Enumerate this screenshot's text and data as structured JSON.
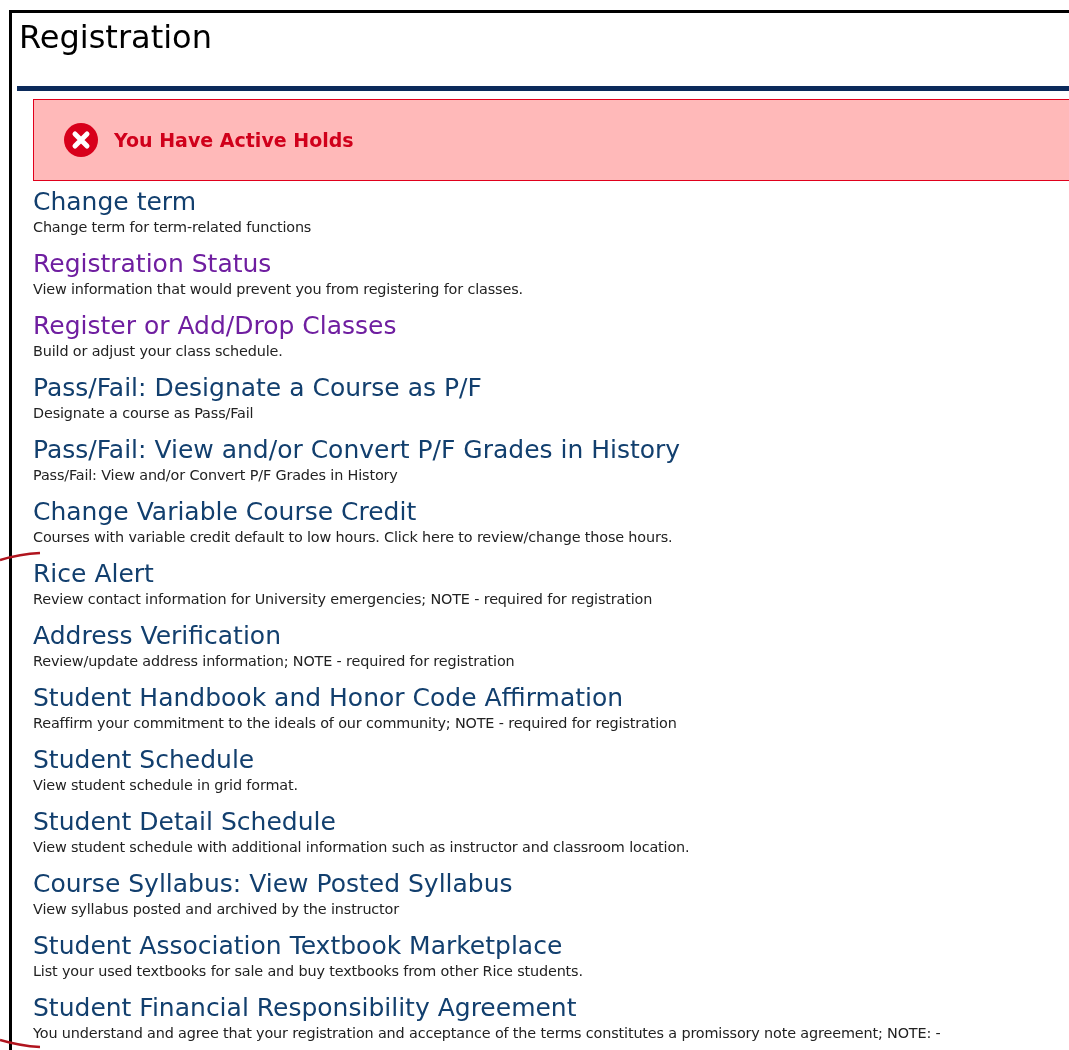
{
  "page": {
    "title": "Registration"
  },
  "alert": {
    "message": "You Have Active Holds"
  },
  "links": [
    {
      "title": "Change term",
      "description": "Change term for term-related functions",
      "visited": false
    },
    {
      "title": "Registration Status",
      "description": "View information that would prevent you from registering for classes.",
      "visited": true
    },
    {
      "title": "Register or Add/Drop Classes",
      "description": "Build or adjust your class schedule.",
      "visited": true
    },
    {
      "title": "Pass/Fail: Designate a Course as P/F",
      "description": "Designate a course as Pass/Fail",
      "visited": false
    },
    {
      "title": "Pass/Fail: View and/or Convert P/F Grades in History",
      "description": "Pass/Fail: View and/or Convert P/F Grades in History",
      "visited": false
    },
    {
      "title": "Change Variable Course Credit",
      "description": "Courses with variable credit default to low hours. Click here to review/change those hours.",
      "visited": false
    },
    {
      "title": "Rice Alert",
      "description": "Review contact information for University emergencies; NOTE - required for registration",
      "visited": false
    },
    {
      "title": "Address Verification",
      "description": "Review/update address information; NOTE - required for registration",
      "visited": false
    },
    {
      "title": "Student Handbook and Honor Code Affirmation",
      "description": "Reaffirm your commitment to the ideals of our community; NOTE - required for registration",
      "visited": false
    },
    {
      "title": "Student Schedule",
      "description": "View student schedule in grid format.",
      "visited": false
    },
    {
      "title": "Student Detail Schedule",
      "description": "View student schedule with additional information such as instructor and classroom location.",
      "visited": false
    },
    {
      "title": "Course Syllabus: View Posted Syllabus",
      "description": "View syllabus posted and archived by the instructor",
      "visited": false
    },
    {
      "title": "Student Association Textbook Marketplace",
      "description": "List your used textbooks for sale and buy textbooks from other Rice students.",
      "visited": false
    },
    {
      "title": "Student Financial Responsibility Agreement",
      "description": "You understand and agree that your registration and acceptance of the terms constitutes a promissory note agreement; NOTE: -",
      "visited": false
    }
  ]
}
